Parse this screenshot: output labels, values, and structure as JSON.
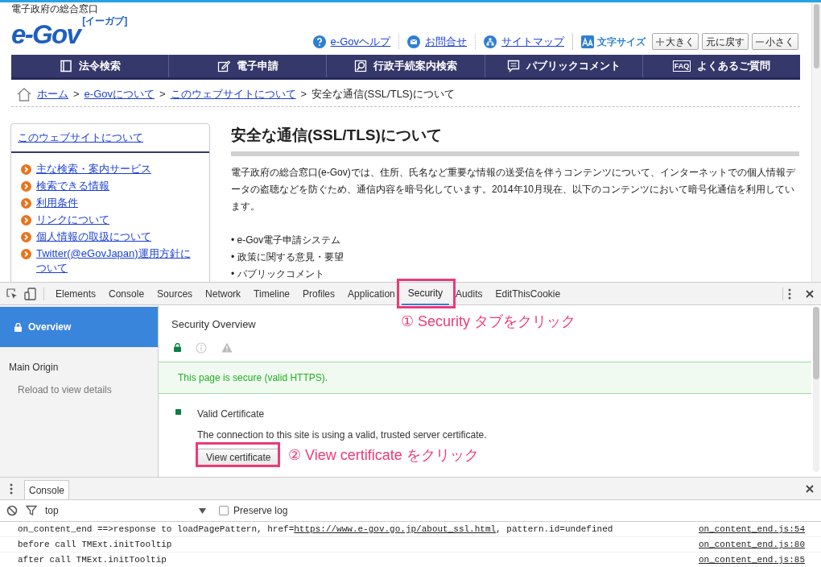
{
  "site": {
    "tagline": "電子政府の総合窓口",
    "logo": "e-Gov",
    "logo_sub": "[イーガブ]",
    "header_links": [
      {
        "kind": "help",
        "label": "e-Govヘルプ"
      },
      {
        "kind": "mail",
        "label": "お問合せ"
      },
      {
        "kind": "sitemap",
        "label": "サイトマップ"
      }
    ],
    "font_size_label": "文字サイズ",
    "font_buttons": [
      {
        "kind": "plus",
        "label": "大きく"
      },
      {
        "kind": "plain",
        "label": "元に戻す"
      },
      {
        "kind": "minus",
        "label": "小さく"
      }
    ],
    "nav": [
      {
        "kind": "book",
        "label": "法令検索"
      },
      {
        "kind": "pencil",
        "label": "電子申請"
      },
      {
        "kind": "search",
        "label": "行政手続案内検索"
      },
      {
        "kind": "comment",
        "label": "パブリックコメント"
      },
      {
        "kind": "faq",
        "badge": "FAQ",
        "label": "よくあるご質問"
      }
    ],
    "breadcrumb": [
      {
        "label": "ホーム",
        "link": true
      },
      {
        "label": "e-Govについて",
        "link": true
      },
      {
        "label": "このウェブサイトについて",
        "link": true
      },
      {
        "label": "安全な通信(SSL/TLS)について",
        "link": false
      }
    ],
    "breadcrumb_separator": ">",
    "sidebar": {
      "title": "このウェブサイトについて",
      "items": [
        "主な検索・案内サービス",
        "検索できる情報",
        "利用条件",
        "リンクについて",
        "個人情報の取扱について",
        "Twitter(@eGovJapan)運用方針について"
      ]
    },
    "heading": "安全な通信(SSL/TLS)について",
    "paragraph": "電子政府の総合窓口(e-Gov)では、住所、氏名など重要な情報の送受信を伴うコンテンツについて、インターネットでの個人情報データの盗聴などを防ぐため、通信内容を暗号化しています。2014年10月現在、以下のコンテンツにおいて暗号化通信を利用しています。",
    "bullets": [
      "• e-Gov電子申請システム",
      "• 政策に関する意見・要望",
      "• パブリックコメント"
    ]
  },
  "devtools": {
    "tabs": [
      {
        "label": "Elements",
        "selected": false
      },
      {
        "label": "Console",
        "selected": false
      },
      {
        "label": "Sources",
        "selected": false
      },
      {
        "label": "Network",
        "selected": false
      },
      {
        "label": "Timeline",
        "selected": false
      },
      {
        "label": "Profiles",
        "selected": false
      },
      {
        "label": "Application",
        "selected": false
      },
      {
        "label": "Security",
        "selected": true
      },
      {
        "label": "Audits",
        "selected": false
      },
      {
        "label": "EditThisCookie",
        "selected": false
      }
    ],
    "security_sidebar": {
      "overview": "Overview",
      "origin_heading": "Main Origin",
      "origin_note": "Reload to view details"
    },
    "overview_title": "Security Overview",
    "secure_message": "This page is secure (valid HTTPS).",
    "certificate": {
      "title": "Valid Certificate",
      "description": "The connection to this site is using a valid, trusted server certificate.",
      "button": "View certificate"
    },
    "drawer_tab": "Console",
    "context": "top",
    "preserve_log": {
      "label": "Preserve log",
      "checked": false
    },
    "messages": [
      {
        "text": "on_content_end ==>response to loadPagePattern, href=",
        "link": "https://www.e-gov.go.jp/about_ssl.html",
        "suffix": ", pattern.id=undefined",
        "source": "on_content_end.js:54"
      },
      {
        "text": "before call TMExt.initTooltip",
        "source": "on_content_end.js:80"
      },
      {
        "text": "after call TMExt.initTooltip",
        "source": "on_content_end.js:85"
      }
    ]
  },
  "annotations": [
    "① Security タブをクリック",
    "② View certificate をクリック"
  ]
}
